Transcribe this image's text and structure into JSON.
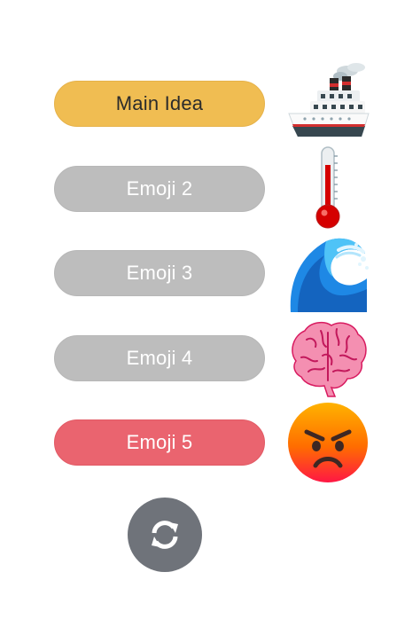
{
  "colors": {
    "main_idea": "#f0bd52",
    "inactive": "#bdbdbd",
    "active_red": "#ea646f",
    "refresh_bg": "#6f737a"
  },
  "rows": [
    {
      "label": "Main Idea",
      "emoji_icon": "cruise-ship-icon"
    },
    {
      "label": "Emoji 2",
      "emoji_icon": "thermometer-icon"
    },
    {
      "label": "Emoji 3",
      "emoji_icon": "water-wave-icon"
    },
    {
      "label": "Emoji 4",
      "emoji_icon": "brain-icon"
    },
    {
      "label": "Emoji 5",
      "emoji_icon": "angry-face-icon"
    }
  ],
  "refresh": {
    "icon": "refresh-icon"
  }
}
